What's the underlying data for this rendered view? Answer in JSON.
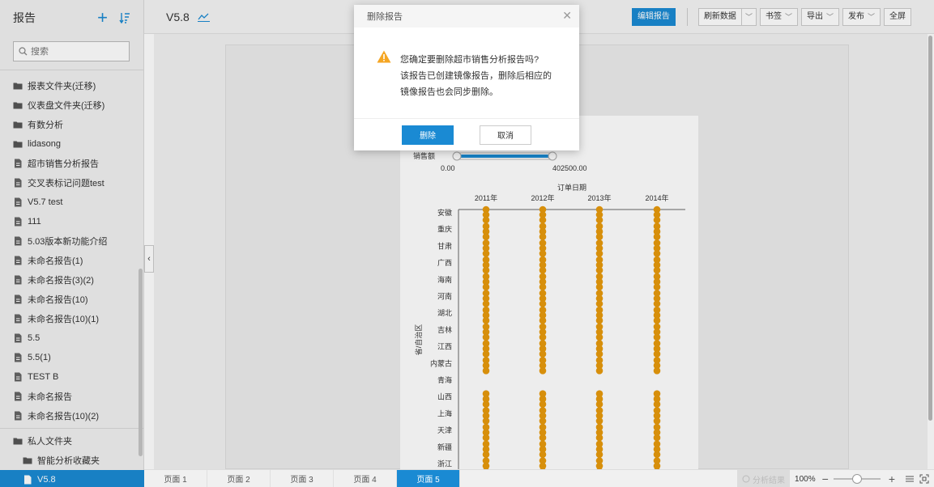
{
  "sidebar": {
    "title": "报告",
    "search_placeholder": "搜索",
    "items": [
      {
        "label": "报表文件夹(迁移)",
        "type": "folder"
      },
      {
        "label": "仪表盘文件夹(迁移)",
        "type": "folder"
      },
      {
        "label": "有数分析",
        "type": "folder"
      },
      {
        "label": "lidasong",
        "type": "folder"
      },
      {
        "label": "超市销售分析报告",
        "type": "report"
      },
      {
        "label": "交叉表标记问题test",
        "type": "report"
      },
      {
        "label": "V5.7 test",
        "type": "report"
      },
      {
        "label": "111",
        "type": "report"
      },
      {
        "label": "5.03版本新功能介绍",
        "type": "report"
      },
      {
        "label": "未命名报告(1)",
        "type": "report"
      },
      {
        "label": "未命名报告(3)(2)",
        "type": "report"
      },
      {
        "label": "未命名报告(10)",
        "type": "report"
      },
      {
        "label": "未命名报告(10)(1)",
        "type": "report"
      },
      {
        "label": "5.5",
        "type": "report"
      },
      {
        "label": "5.5(1)",
        "type": "report"
      },
      {
        "label": "TEST B",
        "type": "report"
      },
      {
        "label": "未命名报告",
        "type": "report"
      },
      {
        "label": "未命名报告(10)(2)",
        "type": "report"
      }
    ],
    "personal_folder": "私人文件夹",
    "smart_folder": "智能分析收藏夹",
    "active_item": "V5.8"
  },
  "topbar": {
    "report_title": "V5.8",
    "edit_label": "编辑报告",
    "refresh_label": "刷新数据",
    "bookmark_label": "书签",
    "export_label": "导出",
    "publish_label": "发布",
    "fullscreen_label": "全屏"
  },
  "bottombar": {
    "pages": [
      "页面 1",
      "页面 2",
      "页面 3",
      "页面 4",
      "页面 5"
    ],
    "active_page_index": 4,
    "analysis_label": "分析结果",
    "zoom": "100%",
    "zoom_slider_fraction": 0.5
  },
  "modal": {
    "title": "删除报告",
    "line1": "您确定要删除超市销售分析报告吗?",
    "line2": "该报告已创建镜像报告，删除后相应的",
    "line3": "镜像报告也会同步删除。",
    "confirm_label": "删除",
    "cancel_label": "取消"
  },
  "chart": {
    "filter_label": "销售额",
    "filter_min": "0.00",
    "filter_max": "402500.00",
    "x_title": "订单日期",
    "y_title": "省/自治区",
    "dot_color": "#e89a0c"
  },
  "chart_data": {
    "type": "scatter",
    "x_title": "订单日期",
    "y_title": "省/自治区",
    "columns": [
      "2011年",
      "2012年",
      "2013年",
      "2014年"
    ],
    "rows": [
      "安徽",
      "重庆",
      "甘肃",
      "广西",
      "海南",
      "河南",
      "湖北",
      "吉林",
      "江西",
      "内蒙古",
      "青海",
      "山西",
      "上海",
      "天津",
      "新疆",
      "浙江"
    ],
    "presence": [
      [
        1,
        1,
        1,
        1
      ],
      [
        1,
        1,
        1,
        1
      ],
      [
        1,
        1,
        1,
        1
      ],
      [
        1,
        1,
        1,
        1
      ],
      [
        1,
        1,
        1,
        1
      ],
      [
        1,
        1,
        1,
        1
      ],
      [
        1,
        1,
        1,
        1
      ],
      [
        1,
        1,
        1,
        1
      ],
      [
        1,
        1,
        1,
        1
      ],
      [
        1,
        1,
        1,
        1
      ],
      [
        0,
        0,
        0,
        0
      ],
      [
        1,
        1,
        1,
        1
      ],
      [
        1,
        1,
        1,
        1
      ],
      [
        1,
        1,
        1,
        1
      ],
      [
        1,
        1,
        1,
        1
      ],
      [
        1,
        1,
        1,
        1
      ]
    ],
    "filter": {
      "field": "销售额",
      "min": 0.0,
      "max": 402500.0
    }
  }
}
